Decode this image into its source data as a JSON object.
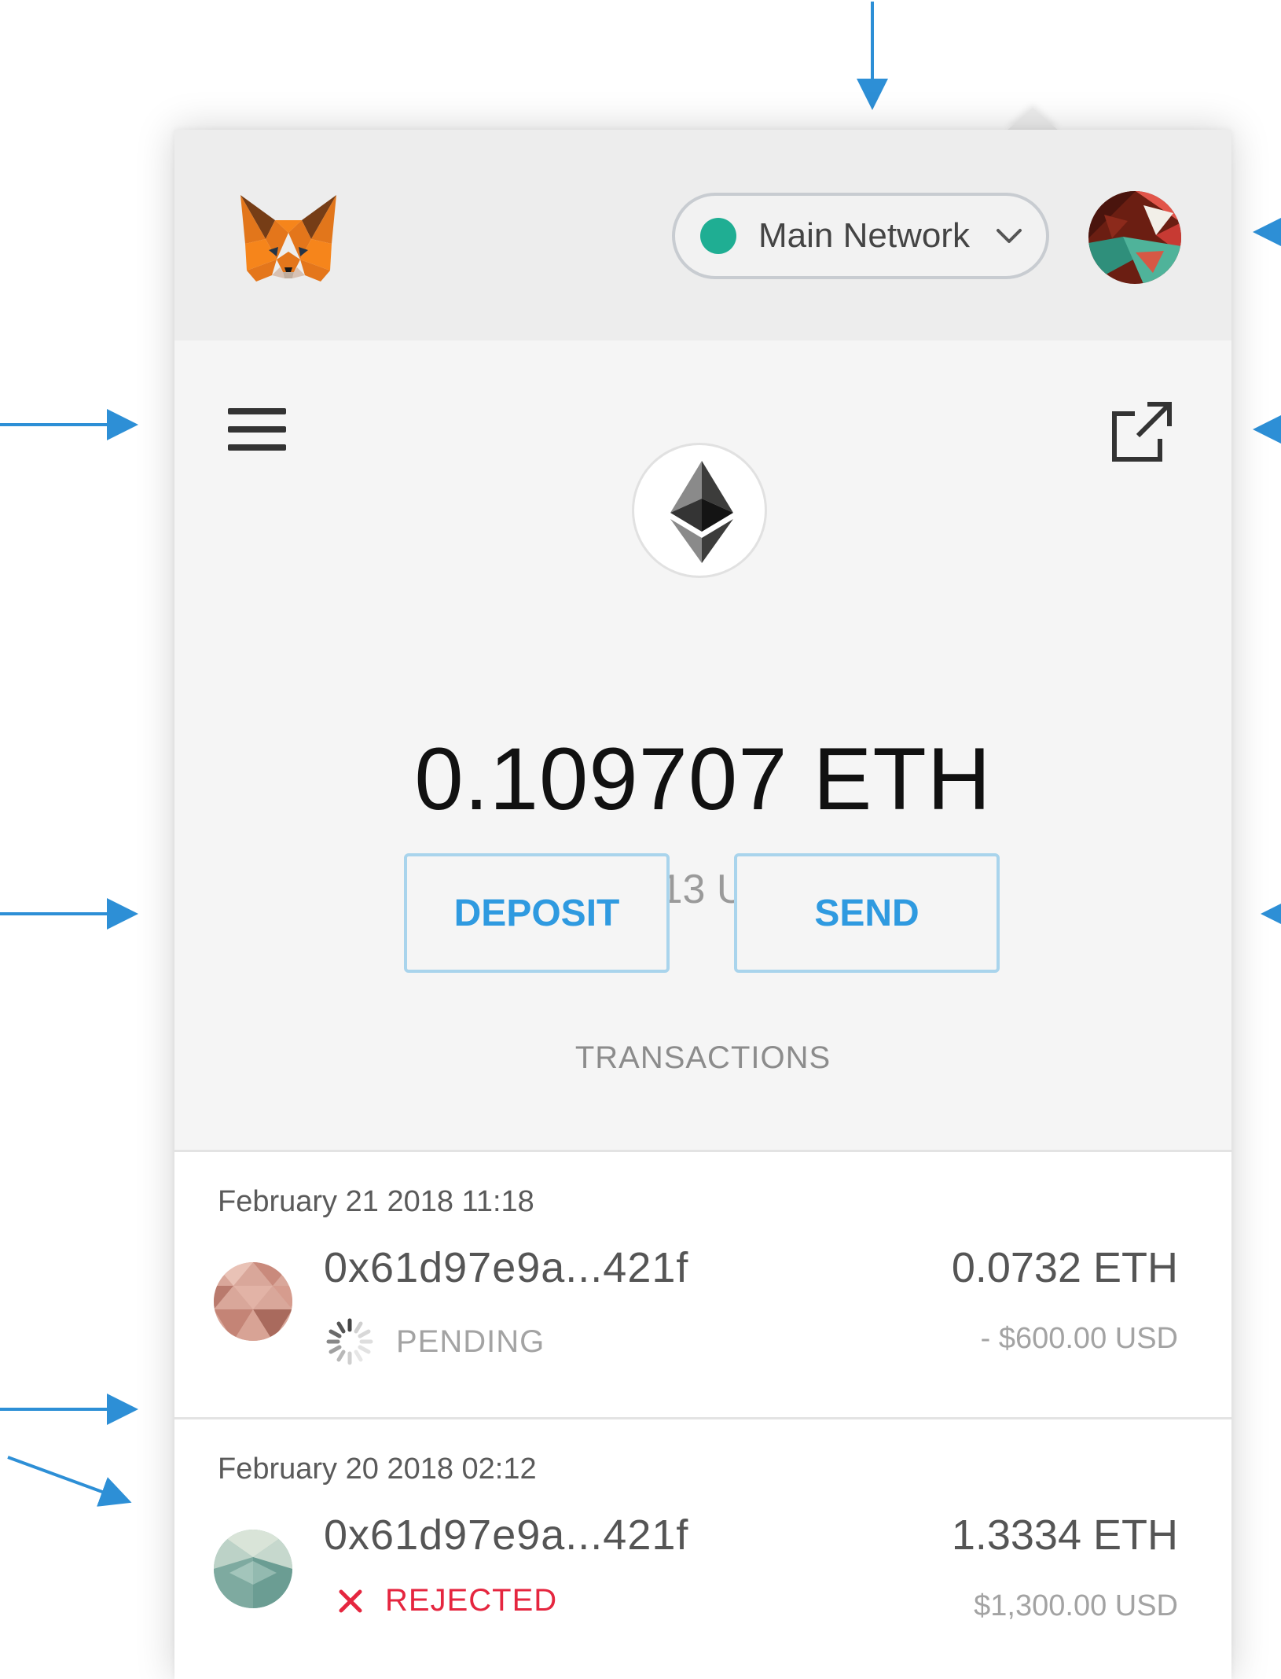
{
  "header": {
    "network": {
      "label": "Main Network",
      "status_color": "#1fae93",
      "icon": "chevron-down-icon"
    },
    "logo": "metamask-fox-logo",
    "account_avatar": "account-identicon"
  },
  "toolbar": {
    "menu_icon": "hamburger-menu-icon",
    "expand_icon": "open-in-new-tab-icon"
  },
  "wallet": {
    "token_icon": "ethereum-icon",
    "balance": "0.109707 ETH",
    "balance_usd": "96.13 USD",
    "deposit_label": "DEPOSIT",
    "send_label": "SEND"
  },
  "transactions": {
    "heading": "TRANSACTIONS",
    "items": [
      {
        "date": "February 21 2018 11:18",
        "address": "0x61d97e9a...421f",
        "status": "PENDING",
        "status_icon": "loading-spinner-icon",
        "amount": "0.0732 ETH",
        "fiat": "- $600.00 USD"
      },
      {
        "date": "February 20 2018 02:12",
        "address": "0x61d97e9a...421f",
        "status": "REJECTED",
        "status_icon": "x-icon",
        "amount": "1.3334 ETH",
        "fiat": "$1,300.00 USD"
      }
    ]
  },
  "colors": {
    "accent": "#2f9ae0",
    "annotation": "#2d8fd6",
    "rejected": "#e5263f",
    "pending": "#a3a3a3"
  }
}
